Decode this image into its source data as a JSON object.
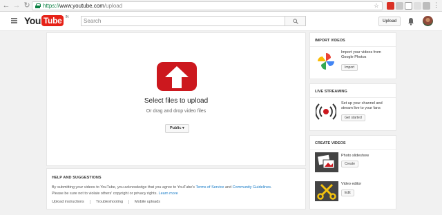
{
  "browser": {
    "url_scheme": "https://",
    "url_host": "www.youtube.com",
    "url_path": "/upload"
  },
  "header": {
    "logo_you": "You",
    "logo_tube": "Tube",
    "logo_region": "IN",
    "search_placeholder": "Search",
    "upload_label": "Upload"
  },
  "upload": {
    "title": "Select files to upload",
    "subtitle": "Or drag and drop video files",
    "privacy_value": "Public"
  },
  "help": {
    "title": "HELP AND SUGGESTIONS",
    "line1_pre": "By submitting your videos to YouTube, you acknowledge that you agree to YouTube's ",
    "tos": "Terms of Service",
    "and": " and ",
    "guidelines": "Community Guidelines",
    "line1_post": ".",
    "line2_pre": "Please be sure not to violate others' copyright or privacy rights. ",
    "learn_more": "Learn more",
    "links": [
      "Upload instructions",
      "Troubleshooting",
      "Mobile uploads"
    ]
  },
  "import": {
    "title": "IMPORT VIDEOS",
    "desc_line1": "Import your videos from",
    "desc_line2": "Google Photos",
    "button": "Import"
  },
  "live": {
    "title": "LIVE STREAMING",
    "desc_line1": "Set up your channel and",
    "desc_line2": "stream live to your fans",
    "button": "Get started"
  },
  "create": {
    "title": "CREATE VIDEOS",
    "slideshow_label": "Photo slideshow",
    "slideshow_button": "Create",
    "editor_label": "Video editor",
    "editor_button": "Edit"
  },
  "colors": {
    "brand_red": "#e62117",
    "link_blue": "#167ac6",
    "secure_green": "#0b8043"
  }
}
